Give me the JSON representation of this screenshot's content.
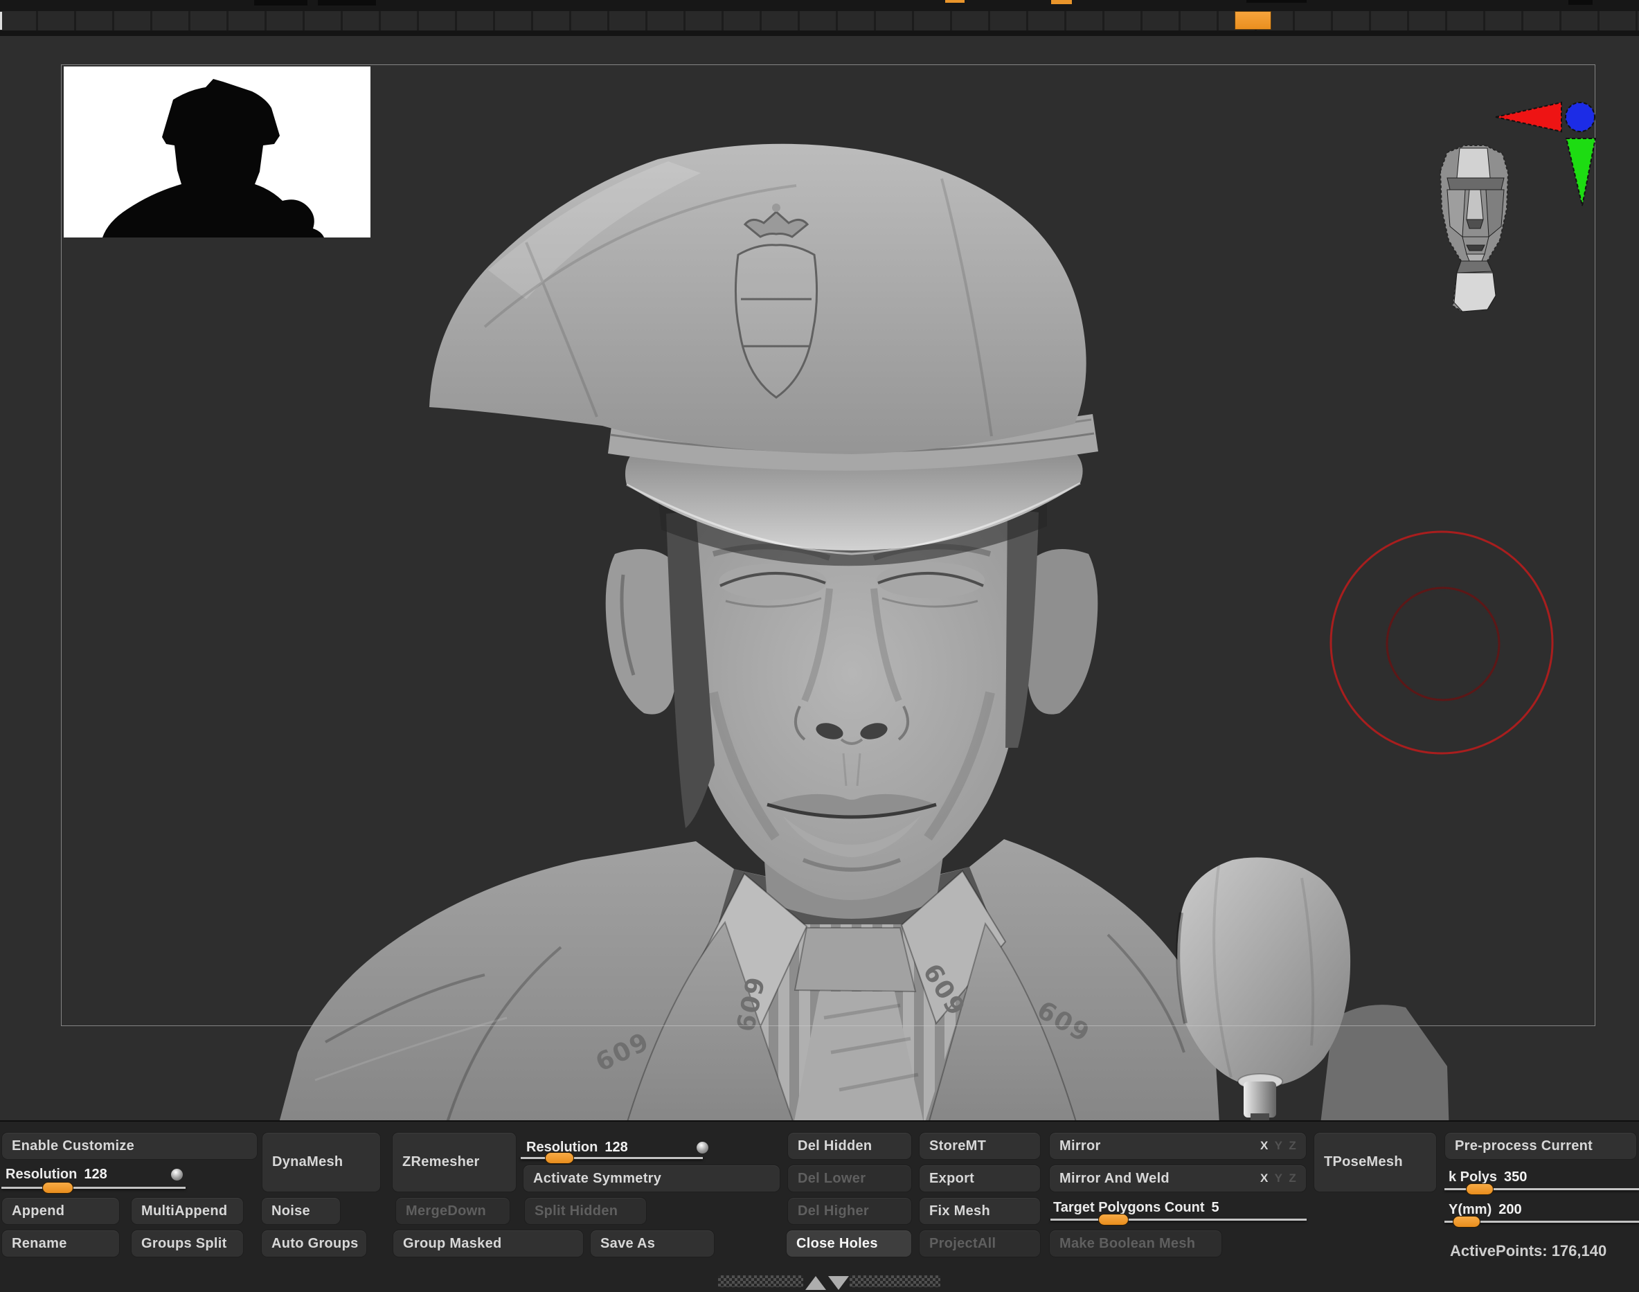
{
  "top_shelf": {
    "active_swatch_color": "#f09a33"
  },
  "canvas": {
    "background": "#2e2e2e",
    "frame_color": "#cdcdcd",
    "collar_number": "609",
    "gizmo": {
      "x_color": "#ee1414",
      "y_color": "#1ddc12",
      "z_color": "#1c2ce6"
    },
    "brush_cursor": {
      "outer_color": "#a81e1e",
      "inner_color": "#5c1717"
    }
  },
  "toolbar": {
    "accent_color": "#f09a33",
    "buttons": {
      "enable_customize": "Enable Customize",
      "dynamesh": "DynaMesh",
      "zremesher": "ZRemesher",
      "activate_symmetry": "Activate Symmetry",
      "append": "Append",
      "multi_append": "MultiAppend",
      "noise": "Noise",
      "merge_down": "MergeDown",
      "split_hidden": "Split Hidden",
      "rename": "Rename",
      "groups_split": "Groups Split",
      "auto_groups": "Auto Groups",
      "group_masked": "Group Masked",
      "save_as": "Save As",
      "del_hidden": "Del Hidden",
      "del_lower": "Del Lower",
      "del_higher": "Del Higher",
      "close_holes": "Close Holes",
      "store_mt": "StoreMT",
      "export": "Export",
      "fix_mesh": "Fix Mesh",
      "project_all": "ProjectAll",
      "mirror": "Mirror",
      "mirror_and_weld": "Mirror And Weld",
      "make_boolean_mesh": "Make Boolean Mesh",
      "tpose_mesh": "TPoseMesh",
      "preprocess_current": "Pre-process Current"
    },
    "sliders": {
      "resolution_left": {
        "label": "Resolution",
        "value": "128"
      },
      "resolution_mid": {
        "label": "Resolution",
        "value": "128"
      },
      "target_polygons": {
        "label": "Target Polygons Count",
        "value": "5"
      },
      "k_polys": {
        "label": "k Polys",
        "value": "350"
      },
      "y_mm": {
        "label": "Y(mm)",
        "value": "200"
      }
    },
    "axes": {
      "x": "X",
      "y": "Y",
      "z": "Z"
    },
    "status": {
      "active_points": "ActivePoints: 176,140"
    }
  }
}
